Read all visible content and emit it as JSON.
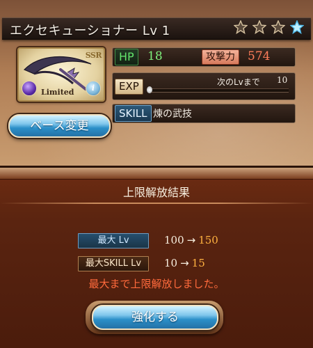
{
  "weapon": {
    "title": "エクセキューショナー Lv 1",
    "stars": [
      {
        "icon": "star-outline-icon",
        "filled": false
      },
      {
        "icon": "star-outline-icon",
        "filled": false
      },
      {
        "icon": "star-outline-icon",
        "filled": false
      },
      {
        "icon": "star-filled-icon",
        "filled": true
      }
    ],
    "rarity": "SSR",
    "limited_label": "Limited",
    "element_icon": "dark-element-orb-icon",
    "info_label": "i",
    "base_change_label": "ベース変更",
    "hp_label": "HP",
    "hp_value": "18",
    "atk_label": "攻撃力",
    "atk_value": "574",
    "exp_label": "EXP",
    "exp_next_label": "次のLvまで",
    "exp_next_value": "10",
    "exp_progress": 0.0,
    "skill_label": "SKILL",
    "skill_name": "煉の武技"
  },
  "result": {
    "title": "上限解放結果",
    "rows": [
      {
        "label": "最大 Lv",
        "from": "100",
        "arrow": "→",
        "to": "150"
      },
      {
        "label": "最大SKILL Lv",
        "from": "10",
        "arrow": "→",
        "to": "15"
      }
    ],
    "message": "最大まで上限解放しました。",
    "enhance_label": "強化する"
  },
  "colors": {
    "panel_brown": "#b07e55",
    "dialog_red_brown": "#5a2410",
    "button_blue": "#2b8fc8",
    "new_value_orange": "#ffb240",
    "message_red": "#ff6a3c",
    "hp_green": "#7ff07c",
    "atk_red": "#ff7d5a"
  }
}
